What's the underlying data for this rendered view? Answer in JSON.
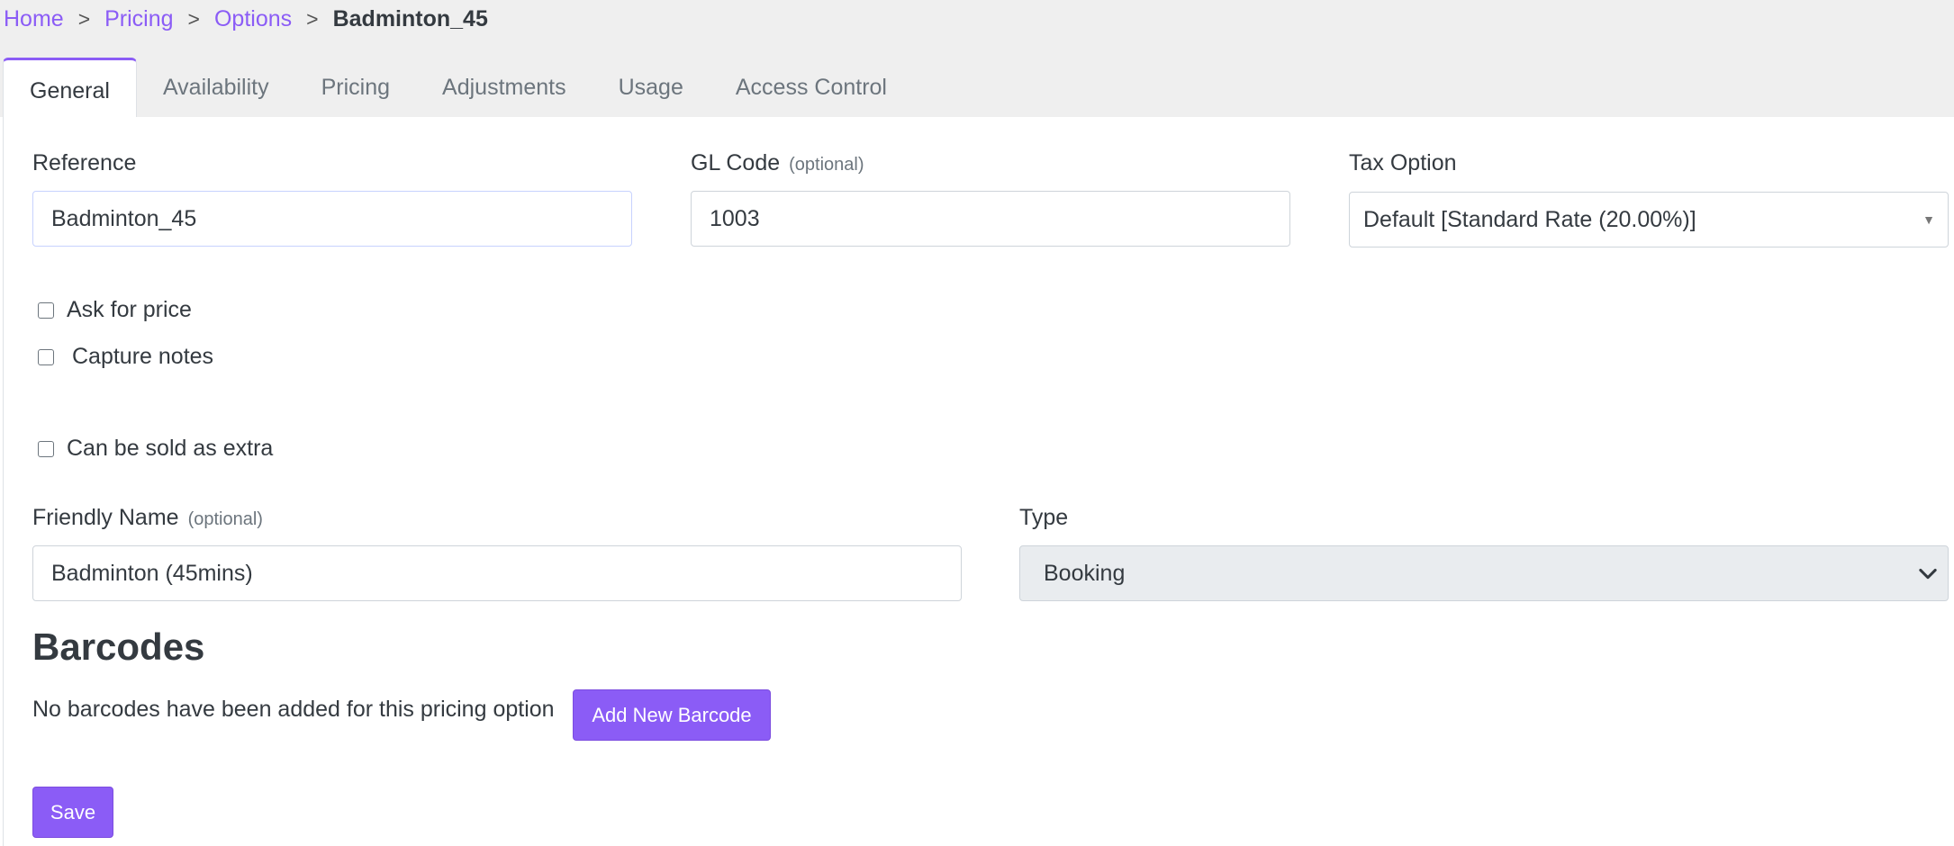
{
  "breadcrumb": {
    "items": [
      "Home",
      "Pricing",
      "Options"
    ],
    "separator": ">",
    "current": "Badminton_45"
  },
  "tabs": [
    "General",
    "Availability",
    "Pricing",
    "Adjustments",
    "Usage",
    "Access Control"
  ],
  "form": {
    "reference": {
      "label": "Reference",
      "value": "Badminton_45"
    },
    "gl_code": {
      "label": "GL Code",
      "optional": "(optional)",
      "value": "1003"
    },
    "tax_option": {
      "label": "Tax Option",
      "value": "Default [Standard Rate (20.00%)]"
    },
    "ask_for_price": "Ask for price",
    "capture_notes": "Capture notes",
    "sold_as_extra": "Can be sold as extra",
    "friendly_name": {
      "label": "Friendly Name",
      "optional": "(optional)",
      "value": "Badminton (45mins)"
    },
    "type": {
      "label": "Type",
      "value": "Booking"
    }
  },
  "barcodes": {
    "heading": "Barcodes",
    "empty_text": "No barcodes have been added for this pricing option",
    "add_label": "Add New Barcode"
  },
  "save_label": "Save",
  "colors": {
    "accent": "#8b5cf6",
    "topbar": "#efefef"
  }
}
